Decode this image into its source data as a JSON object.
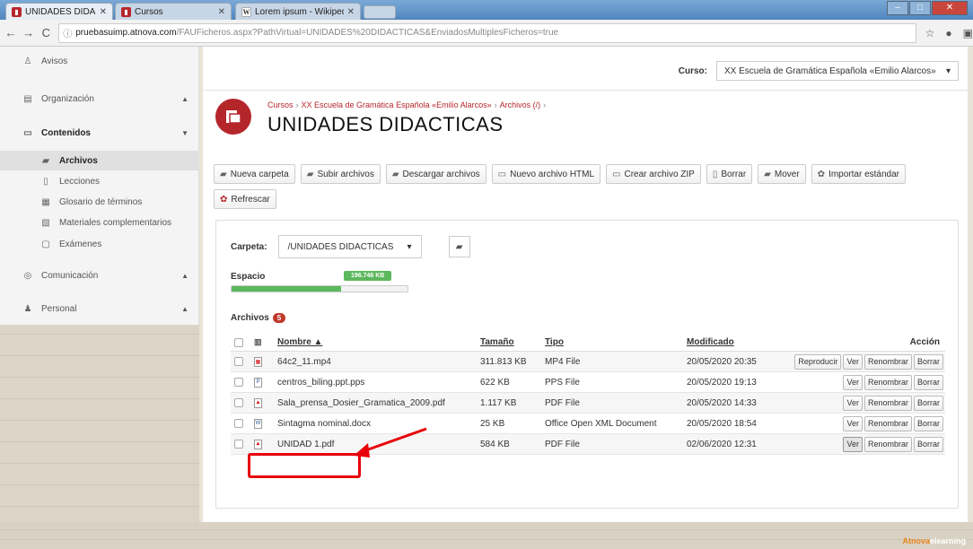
{
  "browser": {
    "tabs": [
      {
        "title": "UNIDADES DIDACTICAS",
        "favicon": "atnova-icon"
      },
      {
        "title": "Cursos",
        "favicon": "atnova-icon"
      },
      {
        "title": "Lorem ipsum - Wikipedia",
        "favicon": "wikipedia-icon"
      }
    ],
    "url_host": "pruebasuimp.atnova.com",
    "url_path": "/FAUFicheros.aspx?PathVirtual=UNIDADES%20DIDACTICAS&EnviadosMultiplesFicheros=true",
    "info_icon": "ⓘ"
  },
  "sidebar": {
    "items": [
      {
        "label": "Avisos",
        "icon": "bell-icon"
      },
      {
        "label": "Organización",
        "icon": "building-icon"
      },
      {
        "label": "Contenidos",
        "icon": "book-icon"
      },
      {
        "label": "Comunicación",
        "icon": "chat-icon"
      },
      {
        "label": "Personal",
        "icon": "user-icon"
      }
    ],
    "sub_items": [
      {
        "label": "Archivos",
        "icon": "folder-icon",
        "active": true
      },
      {
        "label": "Lecciones",
        "icon": "file-icon"
      },
      {
        "label": "Glosario de términos",
        "icon": "glossary-icon"
      },
      {
        "label": "Materiales complementarios",
        "icon": "materials-icon"
      },
      {
        "label": "Exámenes",
        "icon": "exam-icon"
      }
    ]
  },
  "header": {
    "course_label": "Curso:",
    "course_value": "XX Escuela de Gramática Española «Emilio Alarcos»",
    "breadcrumb": [
      "Cursos",
      "XX Escuela de Gramática Española «Emilio Alarcos»",
      "Archivos (/)"
    ],
    "title": "UNIDADES DIDACTICAS"
  },
  "toolbar": {
    "buttons": [
      "Nueva carpeta",
      "Subir archivos",
      "Descargar archivos",
      "Nuevo archivo HTML",
      "Crear archivo ZIP",
      "Borrar",
      "Mover",
      "Importar estándar",
      "Refrescar"
    ]
  },
  "panel": {
    "folder_label": "Carpeta:",
    "folder_value": "/UNIDADES DIDACTICAS",
    "space_label": "Espacio",
    "space_used": "196.746 KB",
    "space_fraction": 0.62,
    "files_label": "Archivos",
    "files_count": "5"
  },
  "table": {
    "headers": {
      "name": "Nombre ▲",
      "size": "Tamaño",
      "type": "Tipo",
      "modified": "Modificado",
      "action": "Acción"
    },
    "rows": [
      {
        "name": "64c2_11.mp4",
        "size": "311.813 KB",
        "type": "MP4 File",
        "modified": "20/05/2020 20:35",
        "actions": [
          "Reproducir",
          "Ver",
          "Renombrar",
          "Borrar"
        ]
      },
      {
        "name": "centros_biling.ppt.pps",
        "size": "622 KB",
        "type": "PPS File",
        "modified": "20/05/2020 19:13",
        "actions": [
          "Ver",
          "Renombrar",
          "Borrar"
        ]
      },
      {
        "name": "Sala_prensa_Dosier_Gramatica_2009.pdf",
        "size": "1.117 KB",
        "type": "PDF File",
        "modified": "20/05/2020 14:33",
        "actions": [
          "Ver",
          "Renombrar",
          "Borrar"
        ]
      },
      {
        "name": "Sintagma nominal.docx",
        "size": "25 KB",
        "type": "Office Open XML Document",
        "modified": "20/05/2020 18:54",
        "actions": [
          "Ver",
          "Renombrar",
          "Borrar"
        ]
      },
      {
        "name": "UNIDAD 1.pdf",
        "size": "584 KB",
        "type": "PDF File",
        "modified": "02/06/2020 12:31",
        "actions": [
          "Ver",
          "Renombrar",
          "Borrar"
        ]
      }
    ]
  },
  "footer": {
    "brand_a": "Atnova",
    "brand_b": "elearning"
  },
  "colors": {
    "accent": "#b5262b",
    "success": "#5cb85c",
    "annotation": "#e8000a"
  }
}
